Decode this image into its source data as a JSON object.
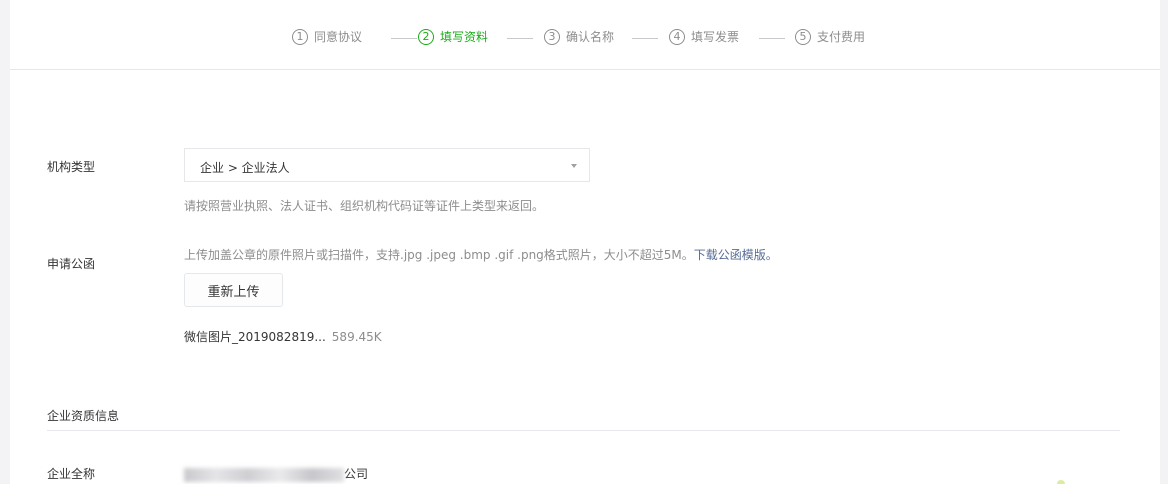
{
  "steps": [
    {
      "num": "1",
      "label": "同意协议"
    },
    {
      "num": "2",
      "label": "填写资料"
    },
    {
      "num": "3",
      "label": "确认名称"
    },
    {
      "num": "4",
      "label": "填写发票"
    },
    {
      "num": "5",
      "label": "支付费用"
    }
  ],
  "active_step": 2,
  "colors": {
    "accent": "#1aad19",
    "link": "#576b95",
    "muted": "#8d8d8d"
  },
  "org_type": {
    "label": "机构类型",
    "selected": "企业 > 企业法人",
    "tip": "请按照营业执照、法人证书、组织机构代码证等证件上类型来返回。"
  },
  "letter": {
    "label": "申请公函",
    "tip": "上传加盖公章的原件照片或扫描件，支持.jpg .jpeg .bmp .gif .png格式照片，大小不超过5M。",
    "template_link": "下载公函模版。",
    "reupload_label": "重新上传",
    "file_name": "微信图片_2019082819...",
    "file_size": "589.45K"
  },
  "qualification": {
    "section_title": "企业资质信息",
    "full_name_label": "企业全称",
    "full_name_suffix": "公司"
  }
}
